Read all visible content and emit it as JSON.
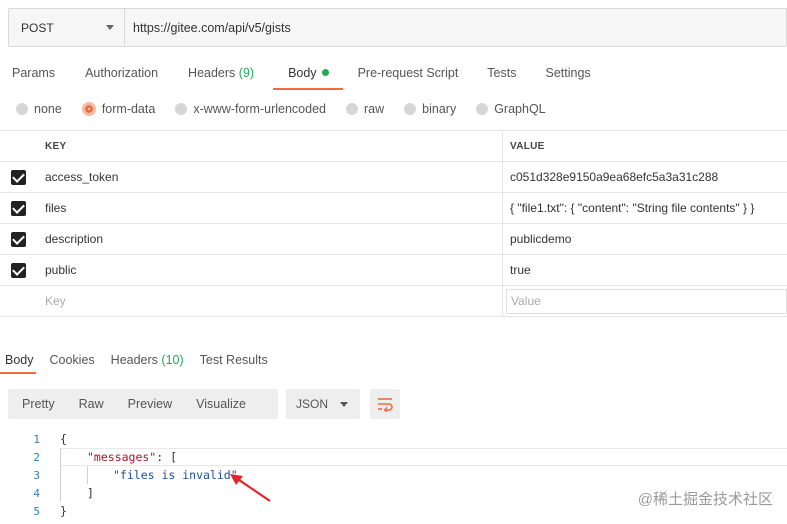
{
  "request": {
    "method": "POST",
    "url": "https://gitee.com/api/v5/gists"
  },
  "request_tabs": [
    {
      "label": "Params",
      "count": ""
    },
    {
      "label": "Authorization",
      "count": ""
    },
    {
      "label": "Headers",
      "count": "(9)"
    },
    {
      "label": "Body",
      "count": ""
    },
    {
      "label": "Pre-request Script",
      "count": ""
    },
    {
      "label": "Tests",
      "count": ""
    },
    {
      "label": "Settings",
      "count": ""
    }
  ],
  "body_types": [
    "none",
    "form-data",
    "x-www-form-urlencoded",
    "raw",
    "binary",
    "GraphQL"
  ],
  "body_selected": "form-data",
  "params_table": {
    "headers": {
      "key": "KEY",
      "value": "VALUE"
    },
    "rows": [
      {
        "key": "access_token",
        "value": "c051d328e9150a9ea68efc5a3a31c288"
      },
      {
        "key": "files",
        "value": "{ \"file1.txt\": { \"content\": \"String file contents\" } }"
      },
      {
        "key": "description",
        "value": "publicdemo"
      },
      {
        "key": "public",
        "value": "true"
      }
    ],
    "empty_row": {
      "key_placeholder": "Key",
      "value_placeholder": "Value"
    }
  },
  "response_tabs": [
    {
      "label": "Body",
      "count": ""
    },
    {
      "label": "Cookies",
      "count": ""
    },
    {
      "label": "Headers",
      "count": "(10)"
    },
    {
      "label": "Test Results",
      "count": ""
    }
  ],
  "response_toolbar": {
    "views": [
      "Pretty",
      "Raw",
      "Preview",
      "Visualize"
    ],
    "format": "JSON"
  },
  "code_lines": [
    {
      "num": "1",
      "text": "{"
    },
    {
      "num": "2",
      "key": "\"messages\"",
      "rest": ": ["
    },
    {
      "num": "3",
      "str": "\"files is invalid\""
    },
    {
      "num": "4",
      "text": "]"
    },
    {
      "num": "5",
      "text": "}"
    }
  ],
  "watermark": "@稀土掘金技术社区",
  "colors": {
    "accent": "#f26b3a",
    "success": "#26a65b",
    "json_key": "#a0162b",
    "json_string": "#1a4f9c"
  }
}
